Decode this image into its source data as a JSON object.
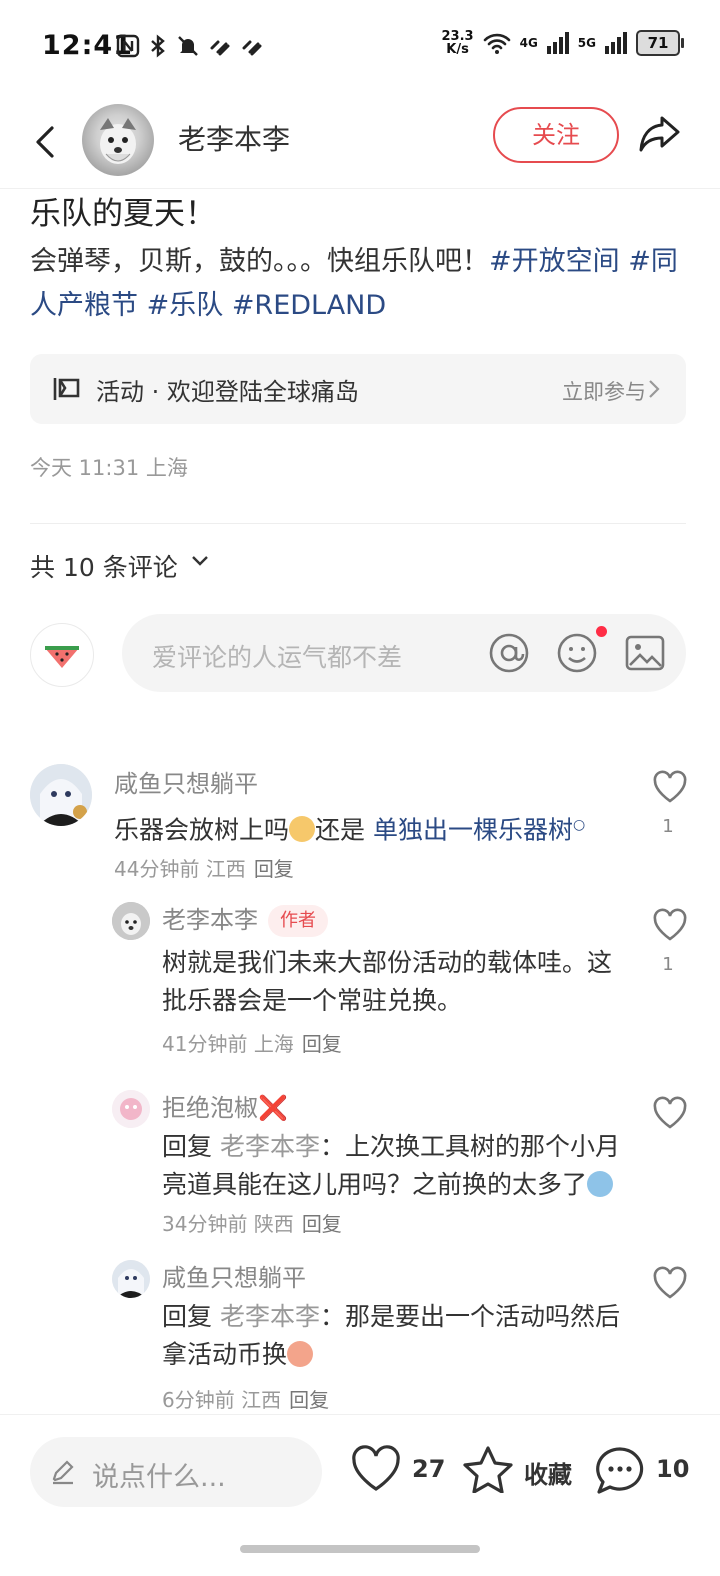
{
  "status_bar": {
    "time": "12:41",
    "speed_value": "23.3",
    "speed_unit": "K/s",
    "network_4g": "4G",
    "network_5g": "5G",
    "battery": "71"
  },
  "header": {
    "author": "老李本李",
    "follow_label": "关注"
  },
  "post": {
    "title": "乐队的夏天！",
    "body_text": "会弹琴，贝斯，鼓的。。。快组乐队吧！",
    "tags": [
      "#开放空间",
      "#同人产粮节",
      "#乐队",
      "#REDLAND"
    ],
    "activity_label": "活动 · 欢迎登陆全球痛岛",
    "activity_join": "立即参与",
    "meta": "今天 11:31 上海"
  },
  "comments_section": {
    "count_label": "共 10 条评论",
    "input_placeholder": "爱评论的人运气都不差"
  },
  "comments": [
    {
      "name": "咸鱼只想躺平",
      "text_a": "乐器会放树上吗",
      "text_b": "还是 ",
      "link": "单独出一棵乐器树",
      "time": "44分钟前",
      "location": "江西",
      "reply": "回复",
      "likes": "1"
    },
    {
      "name": "老李本李",
      "badge": "作者",
      "text": "树就是我们未来大部份活动的载体哇。这批乐器会是一个常驻兑换。",
      "time": "41分钟前",
      "location": "上海",
      "reply": "回复",
      "likes": "1"
    },
    {
      "name": "拒绝泡椒❌",
      "reply_prefix": "回复",
      "reply_to": "老李本李",
      "text": "：上次换工具树的那个小月亮道具能在这儿用吗？之前换的太多了",
      "time": "34分钟前",
      "location": "陕西",
      "reply": "回复"
    },
    {
      "name": "咸鱼只想躺平",
      "reply_prefix": "回复",
      "reply_to": "老李本李",
      "text": "：那是要出一个活动吗然后拿活动币换",
      "time": "6分钟前",
      "location": "江西",
      "reply": "回复"
    }
  ],
  "bottom_bar": {
    "input_placeholder": "说点什么...",
    "like_count": "27",
    "favorite_label": "收藏",
    "comment_count": "10"
  },
  "colors": {
    "accent": "#e64b4f",
    "tag": "#2b4a84",
    "muted": "#999999"
  }
}
